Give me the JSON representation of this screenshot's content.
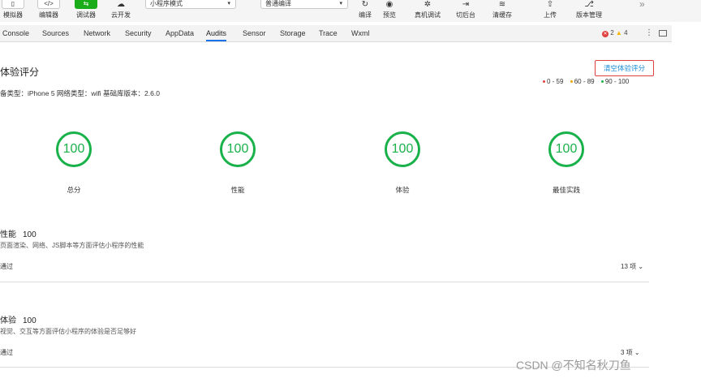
{
  "toolbar": {
    "simulator": {
      "label": "模拟器",
      "icon": "▯"
    },
    "editor": {
      "label": "编辑器",
      "icon": "</>"
    },
    "debugger": {
      "label": "调试器",
      "icon": "⇆"
    },
    "cloud": {
      "label": "云开发",
      "icon": "☁"
    },
    "mode_select": "小程序模式",
    "compile_select": "普通编译",
    "compile": {
      "label": "编译",
      "icon": "↻"
    },
    "preview": {
      "label": "预览",
      "icon": "◉"
    },
    "remote_debug": {
      "label": "真机调试",
      "icon": "✲"
    },
    "background": {
      "label": "切后台",
      "icon": "⇥"
    },
    "clear_cache": {
      "label": "清缓存",
      "icon": "≋"
    },
    "upload": {
      "label": "上传",
      "icon": "⇧"
    },
    "version": {
      "label": "版本管理",
      "icon": "⎇"
    },
    "more": "»"
  },
  "tabs": [
    "Console",
    "Sources",
    "Network",
    "Security",
    "AppData",
    "Audits",
    "Sensor",
    "Storage",
    "Trace",
    "Wxml"
  ],
  "status": {
    "errors": "2",
    "warnings": "4"
  },
  "report": {
    "title": "体验评分",
    "clear_button": "清空体验评分",
    "device_info": "备类型：iPhone 5 网络类型：wifi 基础库版本：2.6.0",
    "legend": [
      {
        "label": "0 - 59",
        "color": "#e0403f"
      },
      {
        "label": "60 - 89",
        "color": "#f4a300"
      },
      {
        "label": "90 - 100",
        "color": "#19b14a"
      }
    ],
    "scores": [
      {
        "value": "100",
        "label": "总分"
      },
      {
        "value": "100",
        "label": "性能"
      },
      {
        "value": "100",
        "label": "体验"
      },
      {
        "value": "100",
        "label": "最佳实践"
      }
    ],
    "sections": [
      {
        "title": "性能",
        "score": "100",
        "desc": "页面渲染、网络、JS脚本等方面评估小程序的性能",
        "pass_label": "通过",
        "count": "13 项 ⌄"
      },
      {
        "title": "体验",
        "score": "100",
        "desc": "视觉、交互等方面评估小程序的体验是否足够好",
        "pass_label": "通过",
        "count": "3 项 ⌄"
      }
    ]
  },
  "watermark": "CSDN @不知名秋刀鱼"
}
